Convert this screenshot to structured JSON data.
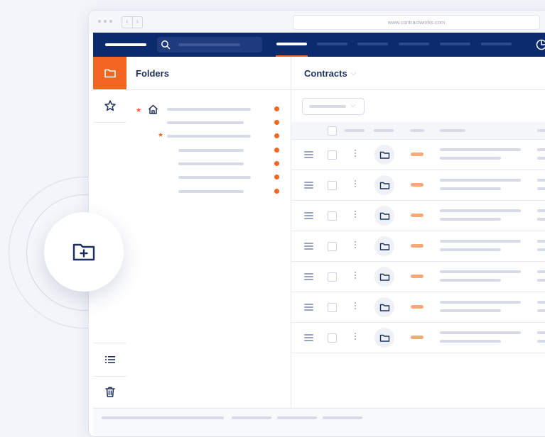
{
  "browser": {
    "url": "www.contractworks.com"
  },
  "folders_panel": {
    "title": "Folders"
  },
  "contracts_panel": {
    "title": "Contracts",
    "title_chevron": "⌵"
  },
  "filter": {
    "chevron": "⌵"
  },
  "browser_nav": {
    "back": "‹",
    "forward": "›"
  },
  "icons": {
    "rail": [
      "folder-icon",
      "star-icon",
      "list-icon",
      "trash-icon"
    ],
    "fab": "folder-plus-icon"
  },
  "colors": {
    "accent": "#f26522",
    "nav": "#0c2b6e",
    "title": "#1c2f5e"
  },
  "contract_rows": 7
}
